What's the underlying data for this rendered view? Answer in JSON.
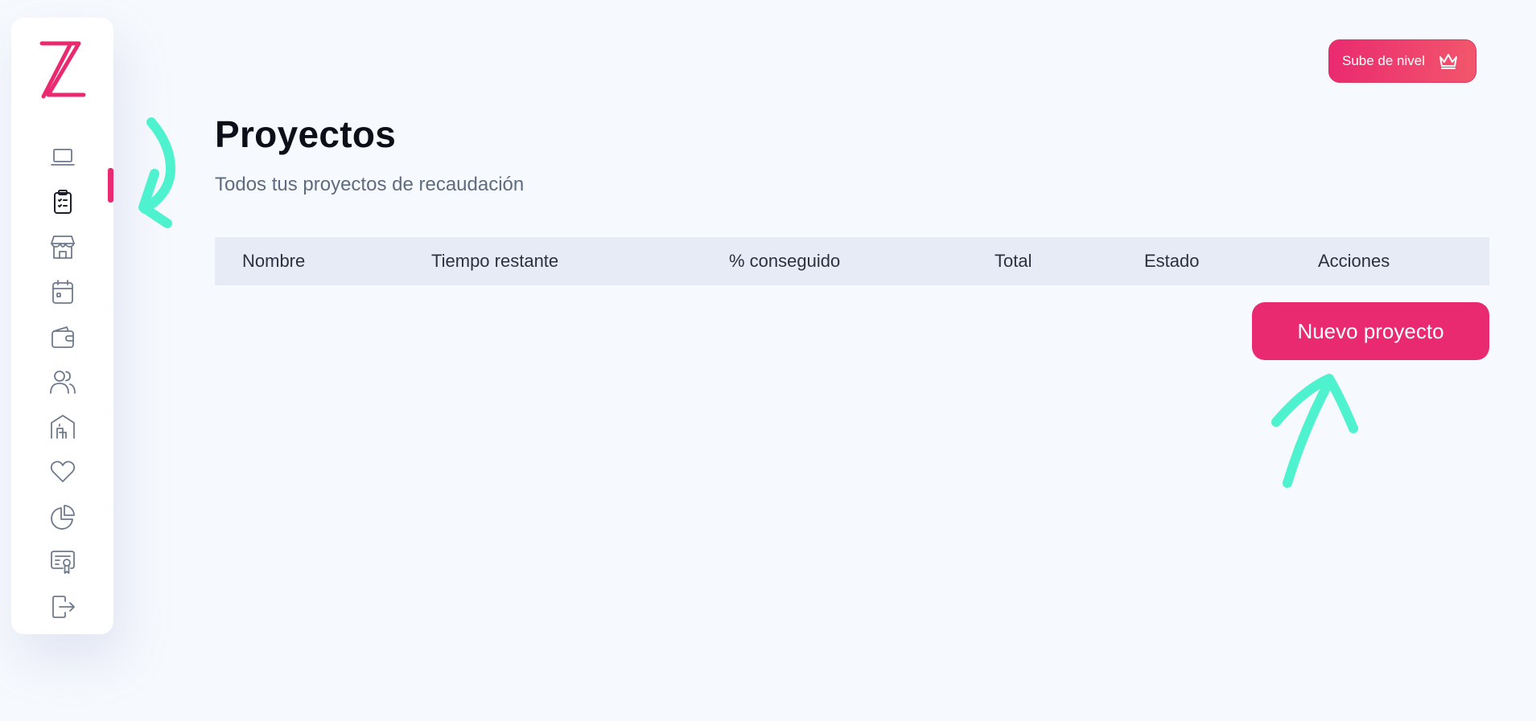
{
  "sidebar": {
    "logo": "Z",
    "items": [
      {
        "icon": "laptop-icon"
      },
      {
        "icon": "clipboard-list-icon",
        "active": true
      },
      {
        "icon": "store-icon"
      },
      {
        "icon": "calendar-icon"
      },
      {
        "icon": "wallet-icon"
      },
      {
        "icon": "users-icon"
      },
      {
        "icon": "building-icon"
      },
      {
        "icon": "heart-icon"
      },
      {
        "icon": "pie-chart-icon"
      },
      {
        "icon": "certificate-icon"
      },
      {
        "icon": "logout-icon"
      }
    ]
  },
  "header": {
    "upgrade_label": "Sube de nivel",
    "upgrade_icon": "crown-icon"
  },
  "page": {
    "title": "Proyectos",
    "subtitle": "Todos tus proyectos de recaudación"
  },
  "table": {
    "columns": [
      "Nombre",
      "Tiempo restante",
      "% conseguido",
      "Total",
      "Estado",
      "Acciones"
    ]
  },
  "actions": {
    "new_project_label": "Nuevo proyecto"
  },
  "colors": {
    "accent": "#ea2a70",
    "annotation": "#4ff2cf",
    "background": "#f6f9fd",
    "table_header": "#e6ebf6"
  }
}
